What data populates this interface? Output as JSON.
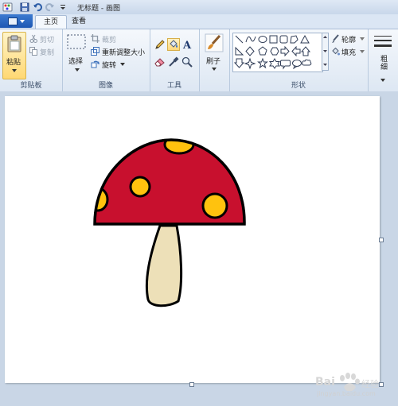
{
  "window": {
    "title": "无标题 - 画图"
  },
  "tabs": [
    {
      "label": "主页",
      "active": true
    },
    {
      "label": "查看",
      "active": false
    }
  ],
  "clipboard": {
    "group_label": "剪贴板",
    "paste": "粘贴",
    "cut": "剪切",
    "copy": "复制"
  },
  "image": {
    "group_label": "图像",
    "select": "选择",
    "crop": "裁剪",
    "resize": "重新调整大小",
    "rotate": "旋转"
  },
  "tools": {
    "group_label": "工具",
    "icons": [
      "pencil-icon",
      "fill-bucket-icon",
      "text-icon",
      "eraser-icon",
      "color-picker-icon",
      "magnifier-icon"
    ]
  },
  "brushes": {
    "label": "刷子"
  },
  "shapes": {
    "group_label": "形状",
    "outline": "轮廓",
    "fill": "填充",
    "icons": [
      "line",
      "curve",
      "oval",
      "rectangle",
      "rounded-rectangle",
      "polygon",
      "triangle",
      "right-triangle",
      "diamond",
      "pentagon",
      "hexagon",
      "right-arrow",
      "left-arrow",
      "up-arrow",
      "down-arrow",
      "four-point-star",
      "five-point-star",
      "six-point-star",
      "rounded-callout",
      "oval-callout",
      "cloud-callout",
      "heart",
      "lightning"
    ]
  },
  "size": {
    "label": "粗细"
  },
  "watermark": {
    "brand": "Bai",
    "brand2": "经验",
    "url": "jingyan.baidu.com"
  },
  "colors": {
    "cap": "#c8102e",
    "spots": "#ffc20e",
    "stem": "#ede0b8",
    "outline": "#000000"
  }
}
